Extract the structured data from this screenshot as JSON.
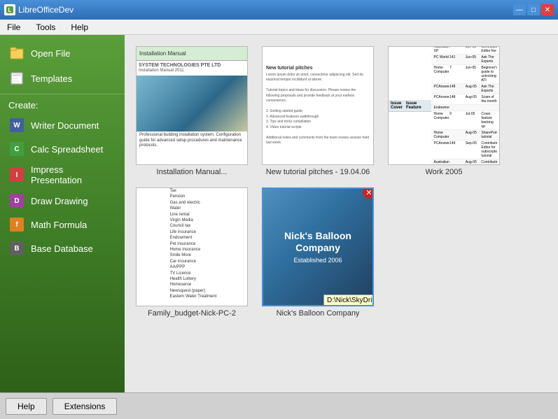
{
  "titlebar": {
    "title": "LibreOfficeDev",
    "icon": "🔷"
  },
  "menubar": {
    "items": [
      "File",
      "Tools",
      "Help"
    ]
  },
  "sidebar": {
    "open_file": "Open File",
    "templates": "Templates",
    "create_label": "Create:",
    "create_items": [
      {
        "id": "writer",
        "label": "Writer Document",
        "icon": "W"
      },
      {
        "id": "calc",
        "label": "Calc Spreadsheet",
        "icon": "C"
      },
      {
        "id": "impress",
        "label": "Impress Presentation",
        "icon": "I"
      },
      {
        "id": "draw",
        "label": "Draw Drawing",
        "icon": "D"
      },
      {
        "id": "math",
        "label": "Math Formula",
        "icon": "M"
      },
      {
        "id": "base",
        "label": "Base Database",
        "icon": "B"
      }
    ]
  },
  "recent": {
    "row1": [
      {
        "id": "install",
        "label": "Installation Manual...",
        "type": "writer"
      },
      {
        "id": "tutorial",
        "label": "New tutorial pitches - 19.04.06",
        "type": "writer"
      },
      {
        "id": "work2005",
        "label": "Work 2005",
        "type": "calc"
      }
    ],
    "row2": [
      {
        "id": "family",
        "label": "Family_budget-Nick-PC-2",
        "type": "calc"
      },
      {
        "id": "balloon",
        "label": "Nick's Balloon Company",
        "type": "impress",
        "has_close": true,
        "path_tooltip": "D:\\Nick\\SkyDrive\\Documents\\Nick's Balloon Company.ppt"
      }
    ]
  },
  "balloon_content": {
    "title": "Nick's Balloon Company",
    "subtitle": "Established 2006"
  },
  "bottombar": {
    "help_label": "Help",
    "extensions_label": "Extensions"
  }
}
